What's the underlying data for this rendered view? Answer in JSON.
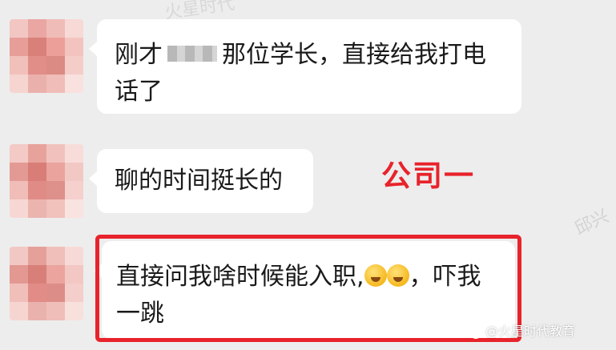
{
  "chat": {
    "messages": [
      {
        "text_before": "刚才",
        "text_after": "那位学长，直接给我打电话了"
      },
      {
        "text": "聊的时间挺长的"
      },
      {
        "text_before": "直接问我啥时候能入职,",
        "text_after": "，吓我一跳",
        "emoji": [
          "laughing-crying-emoji",
          "laughing-crying-emoji"
        ]
      }
    ]
  },
  "annotations": {
    "company_label": "公司一",
    "highlight_color": "#e8232b"
  },
  "watermark": {
    "top_text": "火星时代",
    "side_text": "邱兴",
    "credit_text": "@火星时代教育"
  },
  "colors": {
    "background": "#ededed",
    "bubble": "#ffffff",
    "accent_red": "#e8232b"
  }
}
